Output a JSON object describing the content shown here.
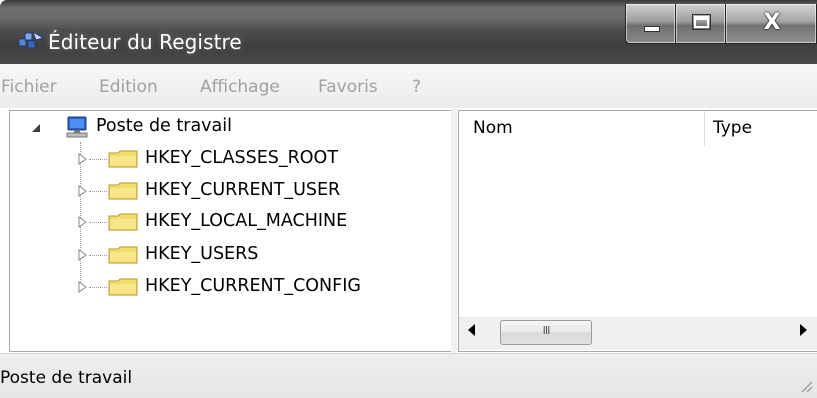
{
  "window": {
    "title": "Éditeur du Registre",
    "close_glyph": "X",
    "icon": "regedit-icon"
  },
  "menu": [
    {
      "label": "Fichier"
    },
    {
      "label": "Edition"
    },
    {
      "label": "Affichage"
    },
    {
      "label": "Favoris"
    },
    {
      "label": "?"
    }
  ],
  "tree": {
    "root": {
      "label": "Poste de travail",
      "icon": "computer-icon",
      "expanded": true
    },
    "children": [
      {
        "label": "HKEY_CLASSES_ROOT",
        "icon": "folder-icon"
      },
      {
        "label": "HKEY_CURRENT_USER",
        "icon": "folder-icon"
      },
      {
        "label": "HKEY_LOCAL_MACHINE",
        "icon": "folder-icon"
      },
      {
        "label": "HKEY_USERS",
        "icon": "folder-icon"
      },
      {
        "label": "HKEY_CURRENT_CONFIG",
        "icon": "folder-icon"
      }
    ]
  },
  "list": {
    "columns": [
      {
        "label": "Nom"
      },
      {
        "label": "Type"
      }
    ],
    "rows": []
  },
  "scrollbar": {
    "thumb_grip": "III"
  },
  "status": {
    "text": "Poste de travail"
  },
  "colors": {
    "titlebar": "#4a4a4a",
    "menu_text_disabled": "#a0a0a0",
    "folder": "#f3dc6a"
  }
}
